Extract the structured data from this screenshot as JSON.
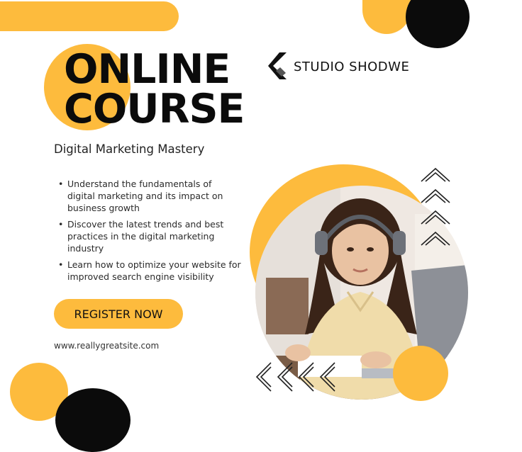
{
  "colors": {
    "accent": "#fdbb3d",
    "dark": "#0b0b0b",
    "background": "#ffffff"
  },
  "title": {
    "line1": "ONLINE",
    "line2": "COURSE"
  },
  "subtitle": "Digital Marketing Mastery",
  "brand": {
    "name": "STUDIO SHODWE",
    "icon": "chevron-logo-icon"
  },
  "bullets": [
    "Understand the fundamentals of digital marketing and its impact on business growth",
    "Discover the latest trends and best practices in the digital marketing industry",
    "Learn how to optimize your website for improved search engine visibility"
  ],
  "cta": {
    "label": "REGISTER NOW"
  },
  "website": "www.reallygreatsite.com",
  "photo": {
    "icon": "student-with-headphones-photo"
  },
  "decorations": {
    "up_chevron_count": 4,
    "left_chevron_count": 4
  }
}
